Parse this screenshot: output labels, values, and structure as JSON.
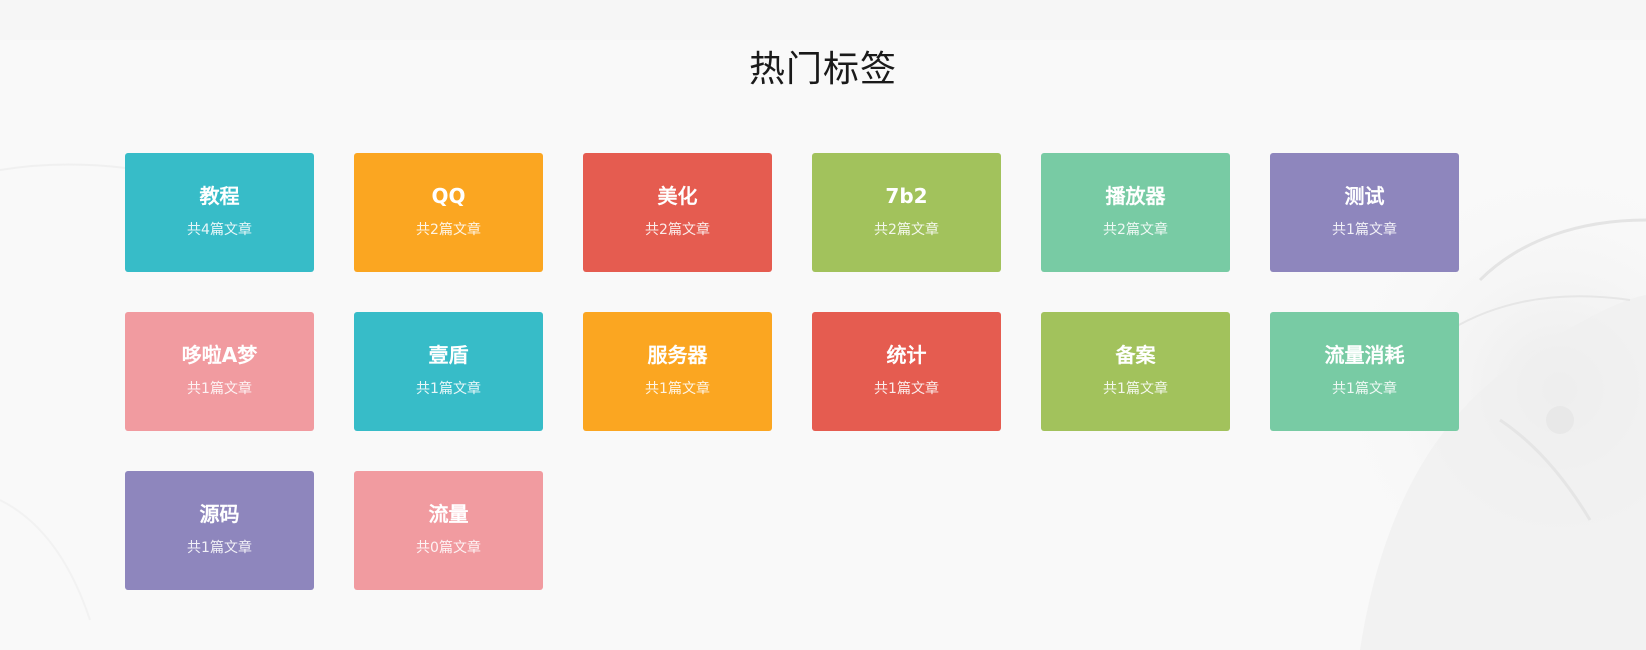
{
  "section": {
    "title": "热门标签"
  },
  "colors": {
    "teal": "#37bcc8",
    "orange": "#fba621",
    "red": "#e55c50",
    "green": "#a2c25c",
    "mint": "#78cba4",
    "purple": "#8e86bd",
    "pink": "#f19ba0"
  },
  "tags": [
    {
      "name": "教程",
      "count": "共4篇文章",
      "color": "#37bcc8"
    },
    {
      "name": "QQ",
      "count": "共2篇文章",
      "color": "#fba621"
    },
    {
      "name": "美化",
      "count": "共2篇文章",
      "color": "#e55c50"
    },
    {
      "name": "7b2",
      "count": "共2篇文章",
      "color": "#a2c25c"
    },
    {
      "name": "播放器",
      "count": "共2篇文章",
      "color": "#78cba4"
    },
    {
      "name": "测试",
      "count": "共1篇文章",
      "color": "#8e86bd"
    },
    {
      "name": "哆啦A梦",
      "count": "共1篇文章",
      "color": "#f19ba0"
    },
    {
      "name": "壹盾",
      "count": "共1篇文章",
      "color": "#37bcc8"
    },
    {
      "name": "服务器",
      "count": "共1篇文章",
      "color": "#fba621"
    },
    {
      "name": "统计",
      "count": "共1篇文章",
      "color": "#e55c50"
    },
    {
      "name": "备案",
      "count": "共1篇文章",
      "color": "#a2c25c"
    },
    {
      "name": "流量消耗",
      "count": "共1篇文章",
      "color": "#78cba4"
    },
    {
      "name": "源码",
      "count": "共1篇文章",
      "color": "#8e86bd"
    },
    {
      "name": "流量",
      "count": "共0篇文章",
      "color": "#f19ba0"
    }
  ]
}
